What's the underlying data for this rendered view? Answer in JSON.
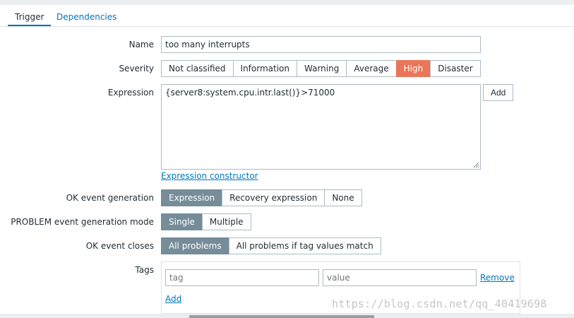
{
  "tabs": {
    "trigger": "Trigger",
    "dependencies": "Dependencies"
  },
  "form": {
    "name_label": "Name",
    "name_value": "too many interrupts",
    "severity_label": "Severity",
    "severity_options": [
      "Not classified",
      "Information",
      "Warning",
      "Average",
      "High",
      "Disaster"
    ],
    "severity_selected": "High",
    "expression_label": "Expression",
    "expression_value": "{server8:system.cpu.intr.last()}>71000",
    "expression_add": "Add",
    "expression_constructor": "Expression constructor",
    "ok_event_generation_label": "OK event generation",
    "ok_event_generation_options": [
      "Expression",
      "Recovery expression",
      "None"
    ],
    "ok_event_generation_selected": "Expression",
    "problem_mode_label": "PROBLEM event generation mode",
    "problem_mode_options": [
      "Single",
      "Multiple"
    ],
    "problem_mode_selected": "Single",
    "ok_event_closes_label": "OK event closes",
    "ok_event_closes_options": [
      "All problems",
      "All problems if tag values match"
    ],
    "ok_event_closes_selected": "All problems",
    "tags_label": "Tags",
    "tag_placeholder": "tag",
    "value_placeholder": "value",
    "tag_remove": "Remove",
    "tag_add": "Add"
  },
  "colors": {
    "link": "#0275b8",
    "selected_option": "#768d99",
    "severity_high": "#e97659"
  },
  "watermark": "https://blog.csdn.net/qq_40419698"
}
